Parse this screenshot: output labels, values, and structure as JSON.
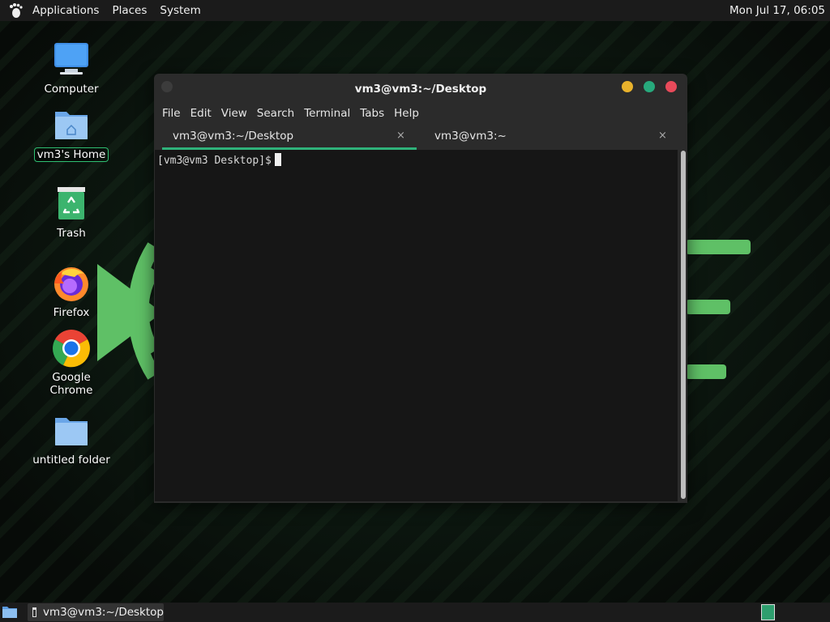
{
  "top_panel": {
    "menus": [
      "Applications",
      "Places",
      "System"
    ],
    "clock": "Mon Jul 17, 06:05"
  },
  "desktop": {
    "icons": [
      {
        "label": "Computer",
        "icon": "computer-icon"
      },
      {
        "label": "vm3's Home",
        "icon": "home-folder-icon",
        "selected": true
      },
      {
        "label": "Trash",
        "icon": "trash-icon"
      },
      {
        "label": "Firefox",
        "icon": "firefox-icon"
      },
      {
        "label": "Google Chrome",
        "icon": "chrome-icon"
      },
      {
        "label": "untitled folder",
        "icon": "folder-icon"
      }
    ]
  },
  "terminal": {
    "title": "vm3@vm3:~/Desktop",
    "menus": [
      "File",
      "Edit",
      "View",
      "Search",
      "Terminal",
      "Tabs",
      "Help"
    ],
    "tabs": [
      {
        "label": "vm3@vm3:~/Desktop",
        "close": "×",
        "active": true
      },
      {
        "label": "vm3@vm3:~",
        "close": "×",
        "active": false
      }
    ],
    "prompt": "[vm3@vm3 Desktop]$",
    "window_buttons": {
      "minimize_color": "#e8b22c",
      "maximize_color": "#27a97c",
      "close_color": "#e84a5a"
    },
    "accent": "#2fb27a"
  },
  "bottom_panel": {
    "task_label": "vm3@vm3:~/Desktop"
  }
}
